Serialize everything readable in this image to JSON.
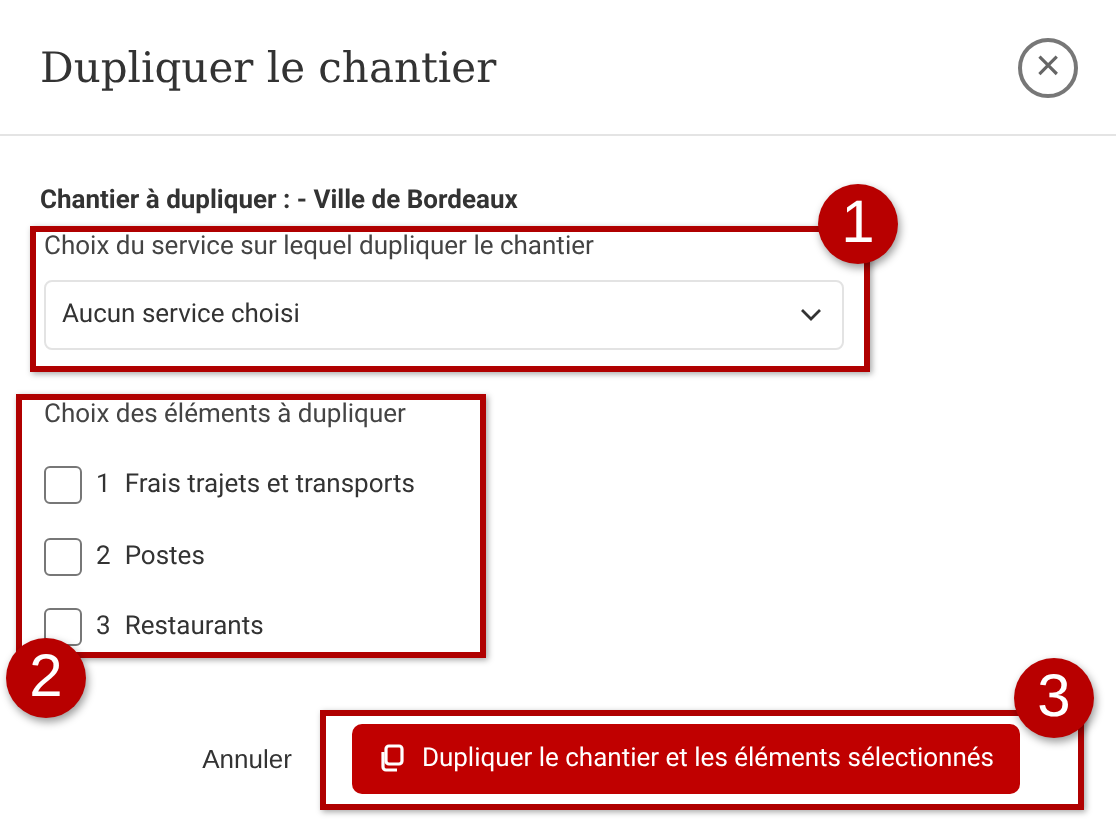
{
  "dialog": {
    "title": "Dupliquer le chantier",
    "close_icon": "×"
  },
  "source_label": "Chantier à dupliquer : - Ville de Bordeaux",
  "service": {
    "label": "Choix du service sur lequel dupliquer le chantier",
    "value": "Aucun service choisi"
  },
  "elements": {
    "label": "Choix des éléments à dupliquer",
    "items": [
      {
        "number": "1",
        "label": "Frais trajets et transports",
        "checked": false
      },
      {
        "number": "2",
        "label": "Postes",
        "checked": false
      },
      {
        "number": "3",
        "label": "Restaurants",
        "checked": false
      }
    ]
  },
  "footer": {
    "cancel": "Annuler",
    "confirm": "Dupliquer le chantier et les éléments sélectionnés"
  },
  "callouts": [
    {
      "number": "1"
    },
    {
      "number": "2"
    },
    {
      "number": "3"
    }
  ]
}
